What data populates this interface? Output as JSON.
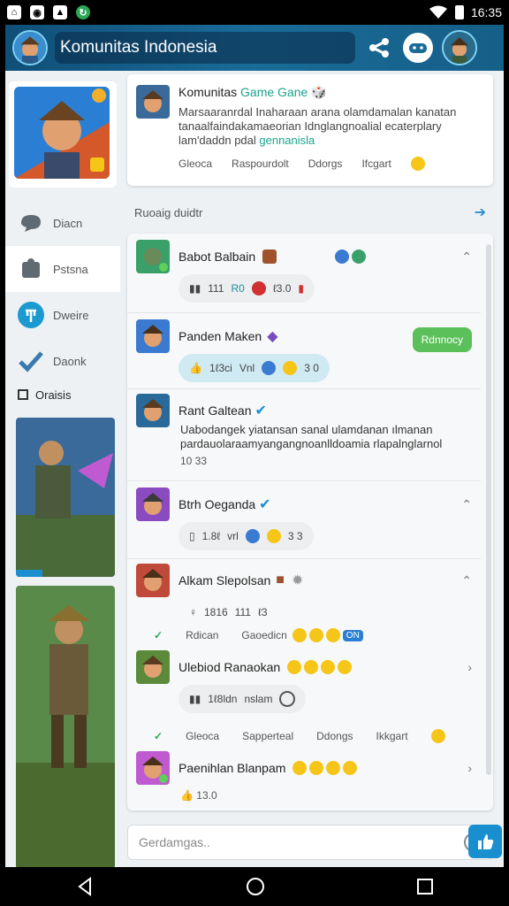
{
  "status_bar": {
    "time": "16:35"
  },
  "header": {
    "title": "Komunitas Indonesia"
  },
  "sidebar": {
    "nav": [
      {
        "label": "Diacn",
        "icon": "chat-icon"
      },
      {
        "label": "Pstsna",
        "icon": "puzzle-icon"
      },
      {
        "label": "Dweire",
        "icon": "trident-icon"
      },
      {
        "label": "Daonk",
        "icon": "check-icon"
      }
    ],
    "checkbox_label": "Oraisis"
  },
  "info_card": {
    "title_prefix": "Komunitas ",
    "title_highlight": "Game Gane",
    "desc_line1": "Marsaaranrdal Inaharaan arana olamdamalan kanatan",
    "desc_line2": "tanaalfaindakamaeorian Idnglangnoalial ecaterplary",
    "desc_line3_prefix": "lam'daddn pdal ",
    "desc_line3_highlight": "gennanisla",
    "actions": [
      "Gleoca",
      "Raspourdolt",
      "Ddorgs",
      "Ifcgart"
    ]
  },
  "section": {
    "label": "Ruoaig duidtr"
  },
  "posts": [
    {
      "name": "Babot Balbain",
      "chip_text": "111",
      "chip_extra": "R0",
      "chip_count": "ℓ3.0"
    },
    {
      "name": "Panden Maken",
      "chip_text": "1ℓ3ci",
      "chip_extra": "Vnl",
      "chip_count": "3 0",
      "reply_label": "Rdnnocy"
    },
    {
      "name": "Rant Galtean",
      "body_line1": "Uabodangek yiatansan sanal ulamdanan ılmanan",
      "body_line2": "pardauolaraamyangangnoanlldoamia rlapalnglarnol",
      "small": "10 33"
    },
    {
      "name": "Btrh Oeganda",
      "chip_text": "1.8ℓ",
      "chip_extra": "vrl",
      "chip_count": "3 3"
    },
    {
      "name": "Alkam Slepolsan",
      "chip_text": "1816",
      "chip_extra": "111",
      "chip_count": "ℓ3"
    },
    {
      "name": "Ulebiod Ranaokan",
      "chip_text": "1ℓ8ldn",
      "chip_extra": "nslam"
    },
    {
      "name": "Paenihlan Blanpam",
      "small": "13.0"
    }
  ],
  "react_row_1": {
    "items": [
      "Rdican",
      "Gaoedicn"
    ],
    "badge": "ON"
  },
  "react_row_2": {
    "items": [
      "Gleoca",
      "Sapperteal",
      "Ddongs",
      "Ikkgart"
    ]
  },
  "composer": {
    "placeholder": "Gerdamgas.."
  },
  "colors": {
    "topbar": "#1a6b98",
    "accent": "#1aa38c",
    "reply": "#5cc05a",
    "send": "#1a8fd0"
  }
}
